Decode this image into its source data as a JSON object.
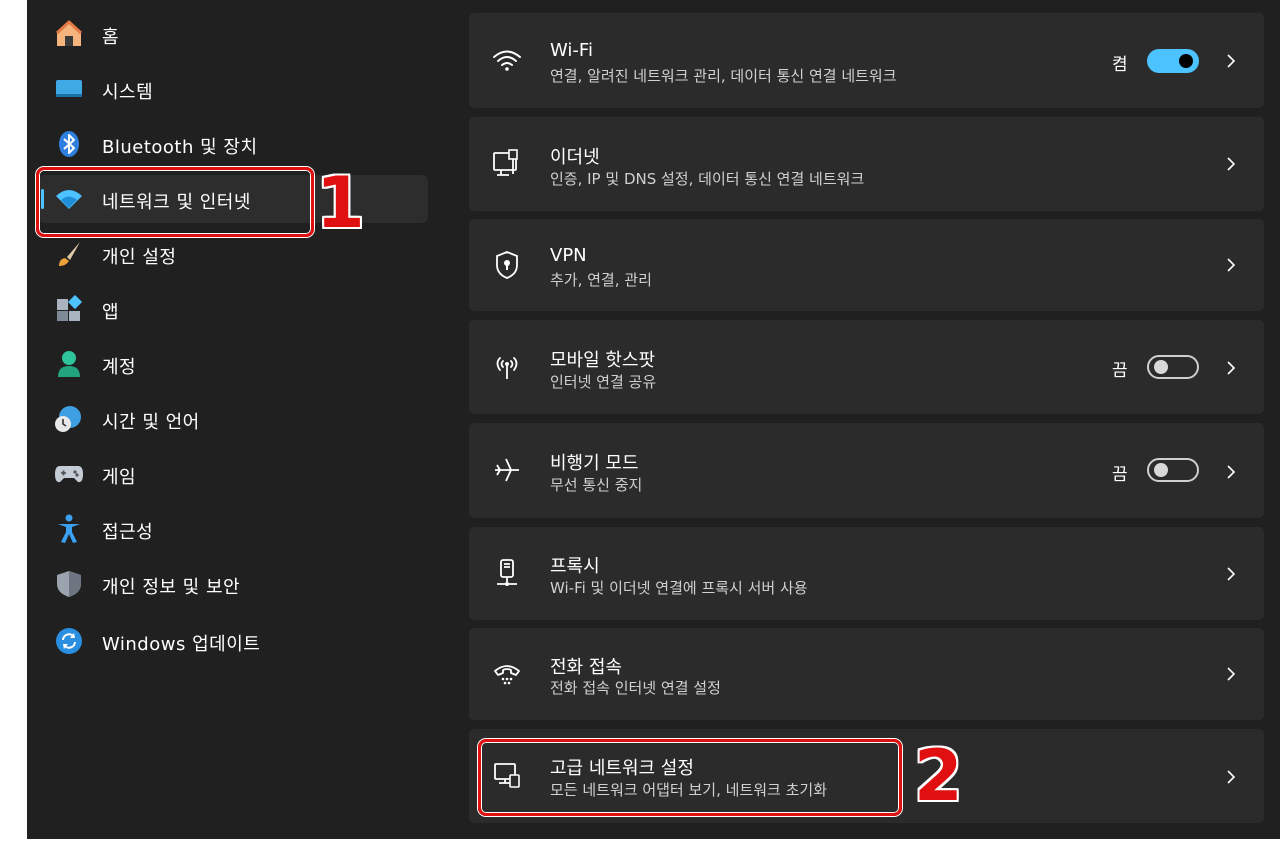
{
  "sidebar": {
    "items": [
      {
        "label": "홈",
        "icon": "home-icon"
      },
      {
        "label": "시스템",
        "icon": "system-monitor-icon"
      },
      {
        "label": "Bluetooth 및 장치",
        "icon": "bluetooth-icon"
      },
      {
        "label": "네트워크 및 인터넷",
        "icon": "wifi-icon",
        "active": true
      },
      {
        "label": "개인 설정",
        "icon": "paintbrush-icon"
      },
      {
        "label": "앱",
        "icon": "apps-icon"
      },
      {
        "label": "계정",
        "icon": "account-icon"
      },
      {
        "label": "시간 및 언어",
        "icon": "globe-clock-icon"
      },
      {
        "label": "게임",
        "icon": "gamepad-icon"
      },
      {
        "label": "접근성",
        "icon": "accessibility-icon"
      },
      {
        "label": "개인 정보 및 보안",
        "icon": "shield-icon"
      },
      {
        "label": "Windows 업데이트",
        "icon": "update-icon"
      }
    ]
  },
  "cards": [
    {
      "title": "Wi-Fi",
      "subtitle": "연결, 알려진 네트워크 관리, 데이터 통신 연결 네트워크",
      "icon": "wifi-icon",
      "toggle_label": "켬",
      "toggle_on": true
    },
    {
      "title": "이더넷",
      "subtitle": "인증, IP 및 DNS 설정, 데이터 통신 연결 네트워크",
      "icon": "ethernet-icon"
    },
    {
      "title": "VPN",
      "subtitle": "추가, 연결, 관리",
      "icon": "vpn-shield-icon"
    },
    {
      "title": "모바일 핫스팟",
      "subtitle": "인터넷 연결 공유",
      "icon": "hotspot-icon",
      "toggle_label": "끔",
      "toggle_on": false
    },
    {
      "title": "비행기 모드",
      "subtitle": "무선 통신 중지",
      "icon": "airplane-icon",
      "toggle_label": "끔",
      "toggle_on": false
    },
    {
      "title": "프록시",
      "subtitle": "Wi-Fi 및 이더넷 연결에 프록시 서버 사용",
      "icon": "proxy-icon"
    },
    {
      "title": "전화 접속",
      "subtitle": "전화 접속 인터넷 연결 설정",
      "icon": "dialup-icon"
    },
    {
      "title": "고급 네트워크 설정",
      "subtitle": "모든 네트워크 어댑터 보기, 네트워크 초기화",
      "icon": "network-adapter-icon"
    }
  ],
  "annotations": {
    "step1": "1",
    "step2": "2"
  },
  "colors": {
    "accent": "#4cc2ff",
    "annotation": "#e01010",
    "background": "#202020",
    "card": "#2b2b2b"
  }
}
